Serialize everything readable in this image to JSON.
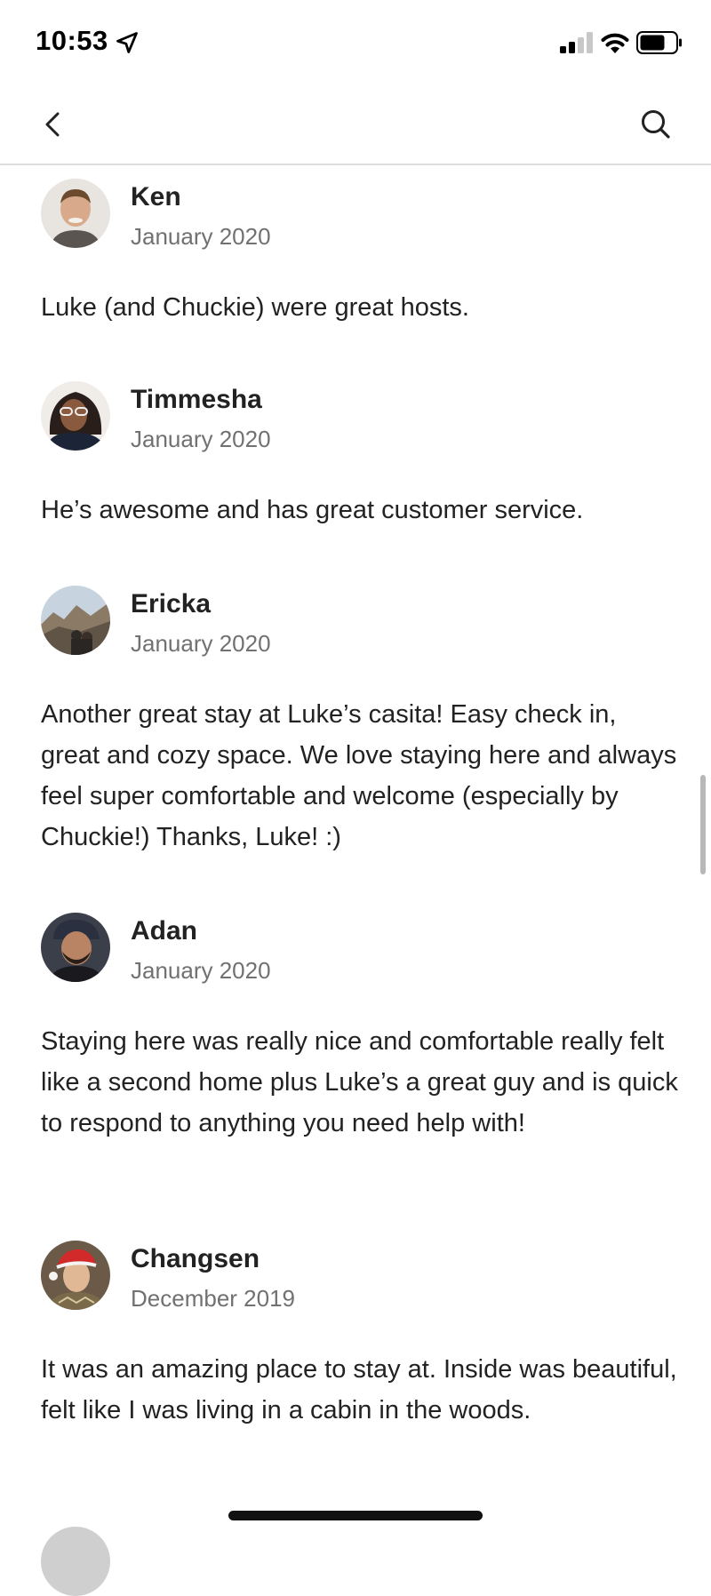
{
  "status_bar": {
    "time": "10:53",
    "icons": [
      "location-arrow-icon",
      "cellular-signal-icon",
      "wifi-icon",
      "battery-icon"
    ]
  },
  "nav": {
    "back_icon": "chevron-left-icon",
    "search_icon": "search-icon"
  },
  "reviews": [
    {
      "name": "Ken",
      "date": "January 2020",
      "text": "Luke (and Chuckie) were great hosts."
    },
    {
      "name": "Timmesha",
      "date": "January 2020",
      "text": "He’s awesome and has great customer service."
    },
    {
      "name": "Ericka",
      "date": "January 2020",
      "text": "Another great stay at Luke’s casita! Easy check in, great and cozy space. We love staying here and always feel super comfortable and welcome (especially by Chuckie!) Thanks, Luke! :)"
    },
    {
      "name": "Adan",
      "date": "January 2020",
      "text": "Staying here was really nice and comfortable really felt like a second home plus Luke’s a great guy and is quick to respond to anything you need help with!"
    },
    {
      "name": "Changsen",
      "date": "December 2019",
      "text": "It was an amazing place to stay at. Inside was beautiful, felt like I was living in a cabin in the woods."
    }
  ],
  "colors": {
    "text_primary": "#222222",
    "text_secondary": "#717171",
    "divider": "#dddddd"
  }
}
